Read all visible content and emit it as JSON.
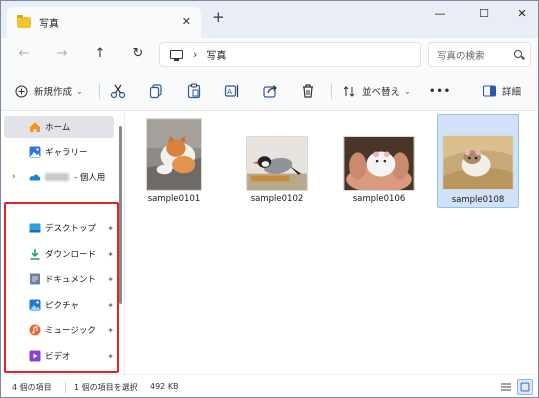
{
  "window": {
    "tab_title": "写真",
    "new_tab": "+",
    "minimize": "—",
    "maximize": "☐",
    "close": "✕"
  },
  "address_bar": {
    "back": "←",
    "forward": "→",
    "up": "↑",
    "refresh": "↻",
    "separator": "›",
    "breadcrumb": "写真",
    "search_placeholder": "写真の検索"
  },
  "toolbar": {
    "new_label": "新規作成",
    "sort_label": "並べ替え",
    "more_label": "•••",
    "details_label": "詳細",
    "icons": [
      "cut-icon",
      "copy-icon",
      "paste-icon",
      "rename-icon",
      "share-icon",
      "delete-icon"
    ]
  },
  "nav_pane": {
    "items": [
      {
        "label": "ホーム",
        "icon": "home-icon",
        "selected": true
      },
      {
        "label": "ギャラリー",
        "icon": "gallery-icon"
      },
      {
        "label": "- 個人用",
        "icon": "onedrive-icon",
        "expandable": true
      },
      {
        "label": "デスクトップ",
        "icon": "desktop-icon",
        "pinned": true
      },
      {
        "label": "ダウンロード",
        "icon": "download-icon",
        "pinned": true
      },
      {
        "label": "ドキュメント",
        "icon": "documents-icon",
        "pinned": true
      },
      {
        "label": "ピクチャ",
        "icon": "pictures-icon",
        "pinned": true
      },
      {
        "label": "ミュージック",
        "icon": "music-icon",
        "pinned": true
      },
      {
        "label": "ビデオ",
        "icon": "video-icon",
        "pinned": true
      }
    ],
    "expander": "›",
    "pin_glyph": "📌"
  },
  "files": [
    {
      "name": "sample0101",
      "subject": "cat"
    },
    {
      "name": "sample0102",
      "subject": "bird"
    },
    {
      "name": "sample0106",
      "subject": "hamster-in-hand"
    },
    {
      "name": "sample0108",
      "subject": "hamster",
      "selected": true
    }
  ],
  "status_bar": {
    "item_count": "4 個の項目",
    "selection": "1 個の項目を選択",
    "size": "492 KB"
  },
  "colors": {
    "accent": "#0067c0",
    "selection_bg": "#cfe2f8",
    "highlight_box": "#e2232a",
    "folder": "#f4c430"
  }
}
